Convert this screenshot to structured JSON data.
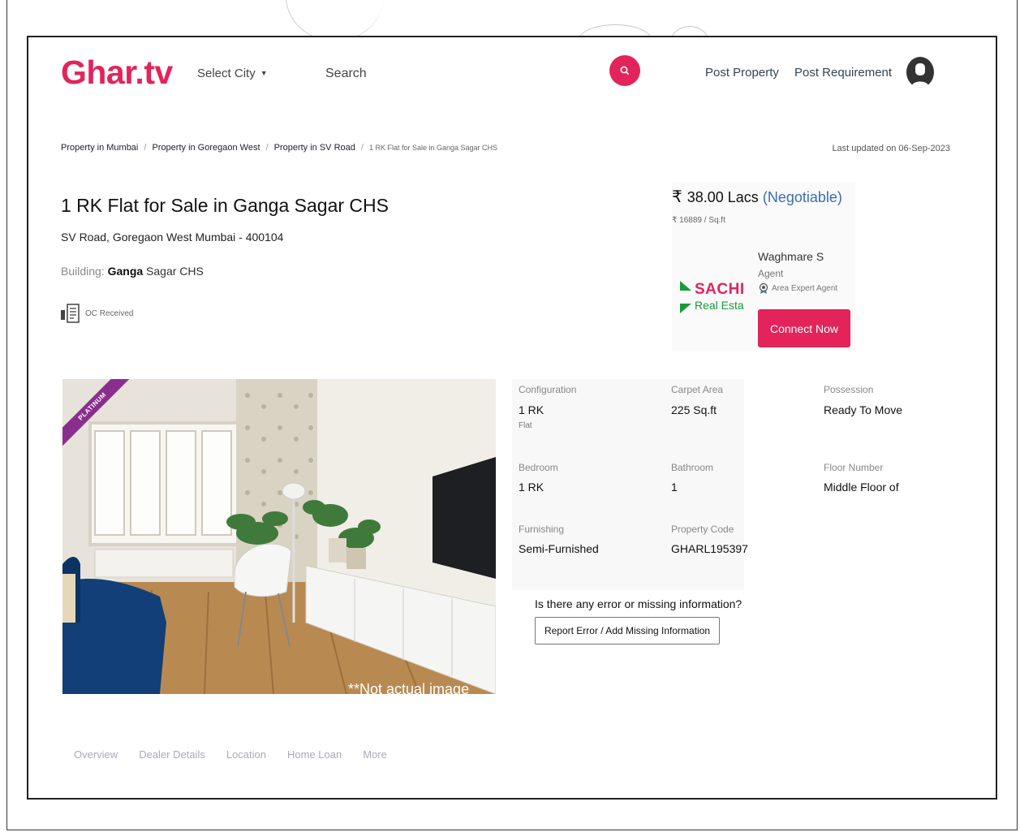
{
  "header": {
    "logo_text": "Ghar.tv",
    "city_select_label": "Select City",
    "search_placeholder": "Search",
    "post_property": "Post Property",
    "post_requirement": "Post Requirement"
  },
  "breadcrumb": {
    "items": [
      "Property in Mumbai",
      "Property in Goregaon West",
      "Property in SV Road",
      "1 RK Flat for Sale in Ganga Sagar CHS"
    ],
    "separator": "/"
  },
  "last_updated": "Last updated on 06-Sep-2023",
  "listing": {
    "title": "1 RK Flat for Sale in Ganga Sagar CHS",
    "address": "SV Road, Goregaon West  Mumbai - 400104",
    "building_label": "Building:",
    "building_name_bold": "Ganga",
    "building_name_rest": " Sagar CHS",
    "oc_status": "OC Received",
    "ribbon": "PLATINUM",
    "image_caption": "**Not actual image"
  },
  "price": {
    "currency_symbol": "₹",
    "amount": "38.00 Lacs",
    "negotiable": "(Negotiable)",
    "per_sqft": "₹ 16889 / Sq.ft"
  },
  "agent": {
    "name": "Waghmare S",
    "role": "Agent",
    "tag": "Area Expert Agent",
    "logo_line1": "SACHI",
    "logo_line2": "Real Esta",
    "connect_label": "Connect Now"
  },
  "specs": {
    "configuration_label": "Configuration",
    "configuration_value": "1 RK",
    "configuration_sub": "Flat",
    "carpet_label": "Carpet Area",
    "carpet_value": "225 Sq.ft",
    "possession_label": "Possession",
    "possession_value": "Ready To Move",
    "bedroom_label": "Bedroom",
    "bedroom_value": "1 RK",
    "bathroom_label": "Bathroom",
    "bathroom_value": "1",
    "floor_label": "Floor Number",
    "floor_value": "Middle Floor of",
    "furnishing_label": "Furnishing",
    "furnishing_value": "Semi-Furnished",
    "code_label": "Property Code",
    "code_value": "GHARL195397"
  },
  "error_prompt": {
    "question": "Is there any error or missing information?",
    "button": "Report Error / Add Missing Information"
  },
  "tabs": [
    "Overview",
    "Dealer Details",
    "Location",
    "Home Loan",
    "More"
  ],
  "colors": {
    "brand": "#e2245b",
    "ribbon": "#8a2e8e",
    "negotiable": "#3a6fb0",
    "agent_logo_green": "#1a9a3a"
  }
}
